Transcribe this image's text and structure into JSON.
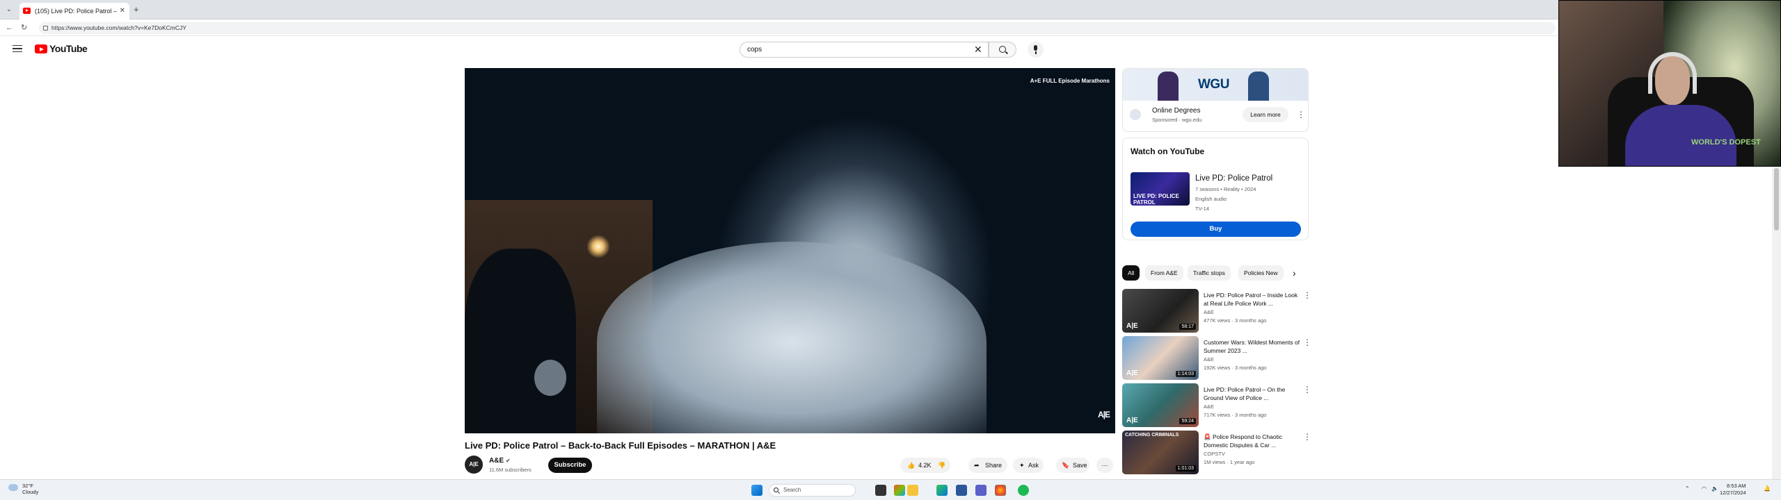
{
  "browser": {
    "tab_title": "(105) Live PD: Police Patrol –",
    "new_tab": "+",
    "url": "https://www.youtube.com/watch?v=Ke7DoKCmCJY"
  },
  "youtube": {
    "logo_text": "YouTube",
    "search_value": "cops",
    "video": {
      "watermark_top": "A+E FULL Episode Marathons",
      "watermark_bottom": "A|E",
      "title": "Live PD: Police Patrol – Back-to-Back Full Episodes – MARATHON | A&E",
      "channel": "A&E",
      "channel_avatar": "A|E",
      "subscribers": "11.6M subscribers",
      "subscribe_label": "Subscribe",
      "likes": "4.2K",
      "share_label": "Share",
      "ask_label": "Ask",
      "save_label": "Save"
    },
    "ad": {
      "brand": "WGU",
      "title": "Online Degrees",
      "sponsored": "Sponsored · wgu.edu",
      "learn_more": "Learn more"
    },
    "watch_card": {
      "heading": "Watch on YouTube",
      "thumb_text": "LIVE PD: POLICE PATROL",
      "title": "Live PD: Police Patrol",
      "meta1": "7 seasons • Reality • 2024",
      "meta2": "English audio",
      "rating": "TV-14",
      "buy_label": "Buy"
    },
    "chips": [
      "All",
      "From A&E",
      "Traffic stops",
      "Policies New"
    ],
    "related": [
      {
        "title": "Live PD: Police Patrol – Inside Look at Real Life Police Work ...",
        "channel": "A&E",
        "meta": "477K views · 3 months ago",
        "duration": "58:17",
        "thumb_label": "A|E"
      },
      {
        "title": "Customer Wars: Wildest Moments of Summer 2023 ...",
        "channel": "A&E",
        "meta": "192K views · 3 months ago",
        "duration": "1:14:03",
        "thumb_label": "A|E"
      },
      {
        "title": "Live PD: Police Patrol – On the Ground View of Police ...",
        "channel": "A&E",
        "meta": "717K views · 3 months ago",
        "duration": "59:24",
        "thumb_label": "A|E"
      },
      {
        "title": "🚨 Police Respond to Chaotic Domestic Disputes & Car ...",
        "channel": "COPSTV",
        "meta": "1M views · 1 year ago",
        "duration": "1:01:03",
        "thumb_label": "CATCHING CRIMINALS"
      }
    ]
  },
  "webcam": {
    "shirt_text": "WORLD'S DOPEST"
  },
  "taskbar": {
    "weather_temp": "32°F",
    "weather_desc": "Cloudy",
    "search_placeholder": "Search",
    "time": "8:53 AM",
    "date": "12/27/2024"
  },
  "colors": {
    "youtube_red": "#FF0000",
    "buy_blue": "#065FD4",
    "subscribe_black": "#0F0F0F"
  }
}
